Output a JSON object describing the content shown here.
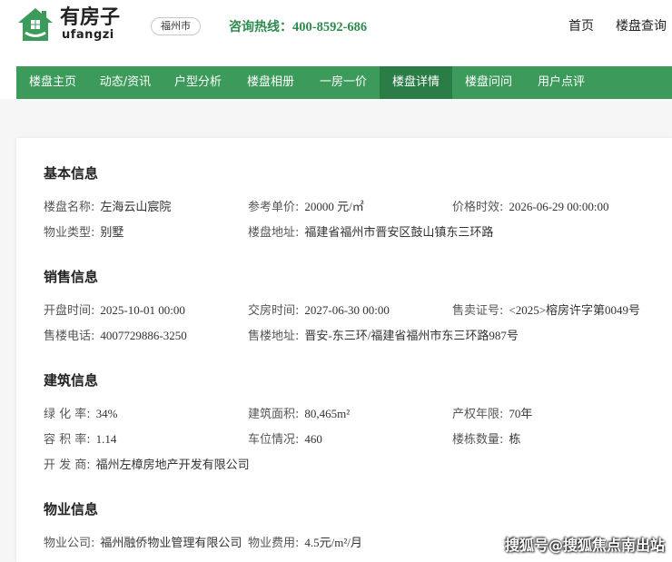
{
  "header": {
    "logo": {
      "title": "有房子",
      "subtitle": "ufangzi"
    },
    "city": "福州市",
    "hotline": {
      "label": "咨询热线：",
      "number": "400-8592-686"
    },
    "links": [
      "首页",
      "楼盘查询"
    ]
  },
  "nav": {
    "items": [
      "楼盘主页",
      "动态/资讯",
      "户型分析",
      "楼盘相册",
      "一房一价",
      "楼盘详情",
      "楼盘问问",
      "用户点评"
    ],
    "active": "楼盘详情"
  },
  "sections": [
    {
      "title": "基本信息",
      "rows": [
        [
          {
            "label": "楼盘名称:",
            "value": "左海云山宸院"
          },
          {
            "label": "参考单价:",
            "value": "20000 元/㎡"
          },
          {
            "label": "价格时效:",
            "value": "2026-06-29 00:00:00"
          }
        ],
        [
          {
            "label": "物业类型:",
            "value": "别墅"
          },
          {
            "label": "楼盘地址:",
            "value": "福建省福州市晋安区鼓山镇东三环路"
          }
        ]
      ]
    },
    {
      "title": "销售信息",
      "rows": [
        [
          {
            "label": "开盘时间:",
            "value": "2025-10-01 00:00"
          },
          {
            "label": "交房时间:",
            "value": "2027-06-30 00:00"
          },
          {
            "label": "售卖证号:",
            "value": "<2025>榕房许字第0049号"
          }
        ],
        [
          {
            "label": "售楼电话:",
            "value": "4007729886-3250"
          },
          {
            "label": "售楼地址:",
            "value": "晋安-东三环/福建省福州市东三环路987号"
          }
        ]
      ]
    },
    {
      "title": "建筑信息",
      "rows": [
        [
          {
            "label": "绿 化 率:",
            "value": "34%"
          },
          {
            "label": "建筑面积:",
            "value": "80,465m²"
          },
          {
            "label": "产权年限:",
            "value": "70年"
          }
        ],
        [
          {
            "label": "容 积 率:",
            "value": "1.14"
          },
          {
            "label": "车位情况:",
            "value": "460"
          },
          {
            "label": "楼栋数量:",
            "value": "栋"
          }
        ],
        [
          {
            "label": "开 发 商:",
            "value": "福州左樟房地产开发有限公司"
          }
        ]
      ]
    },
    {
      "title": "物业信息",
      "rows": [
        [
          {
            "label": "物业公司:",
            "value": "福州融侨物业管理有限公司"
          },
          {
            "label": "物业费用:",
            "value": "4.5元/m²/月"
          }
        ]
      ]
    }
  ],
  "colors": {
    "accent": "#3c9a5b",
    "nav_active": "#2b7d48",
    "hotline": "#2f8a4e"
  },
  "icons": {
    "logo": "house-logo-icon"
  },
  "watermark": "搜狐号@搜狐焦点南出站"
}
